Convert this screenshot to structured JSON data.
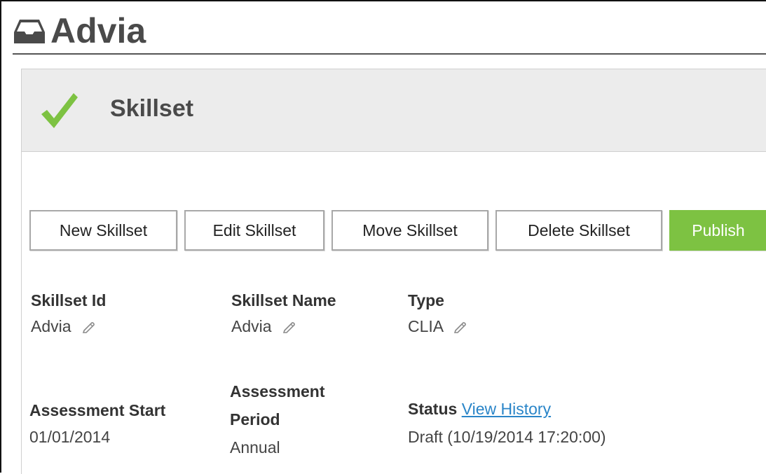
{
  "page": {
    "title": "Advia",
    "header_icon": "inbox-tray-icon"
  },
  "panel": {
    "title": "Skillset",
    "status_icon": "checkmark-icon",
    "status_icon_color": "#7dc242"
  },
  "toolbar": {
    "new_label": "New Skillset",
    "edit_label": "Edit Skillset",
    "move_label": "Move Skillset",
    "delete_label": "Delete Skillset",
    "publish_label": "Publish",
    "publish_color": "#7dc242"
  },
  "details": {
    "skillset_id": {
      "label": "Skillset Id",
      "value": "Advia",
      "edit_icon": "pencil-icon"
    },
    "skillset_name": {
      "label": "Skillset Name",
      "value": "Advia",
      "edit_icon": "pencil-icon"
    },
    "type": {
      "label": "Type",
      "value": "CLIA",
      "edit_icon": "pencil-icon"
    },
    "assessment_start": {
      "label": "Assessment Start",
      "value": "01/01/2014"
    },
    "assessment_period": {
      "label_line1": "Assessment",
      "label_line2": "Period",
      "value": "Annual"
    },
    "status": {
      "label": "Status",
      "link": "View History",
      "value": "Draft (10/19/2014 17:20:00)"
    }
  }
}
